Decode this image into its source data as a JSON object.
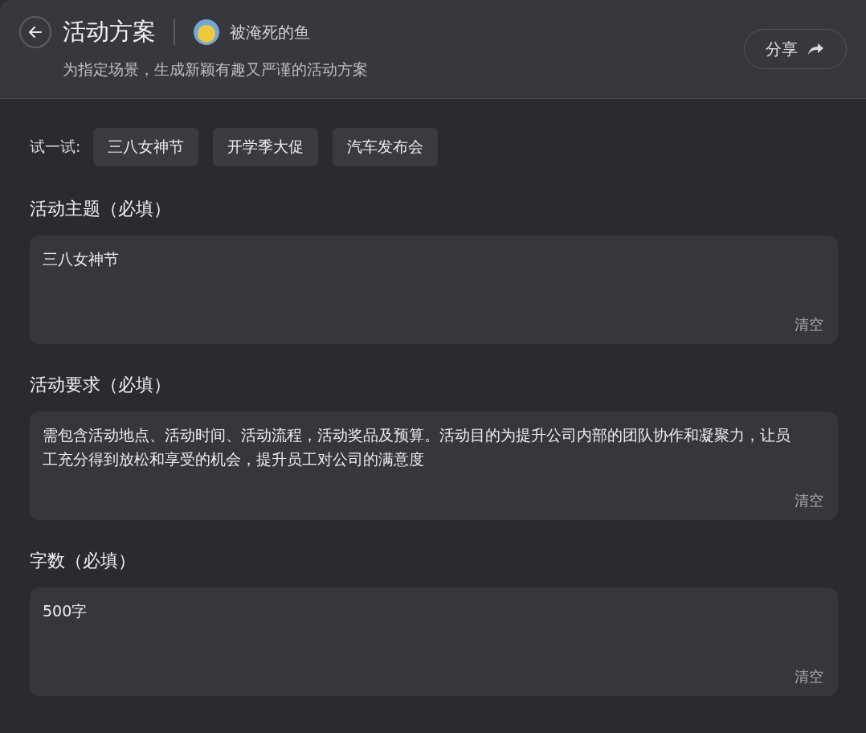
{
  "header": {
    "title": "活动方案",
    "author": "被淹死的鱼",
    "subtitle": "为指定场景，生成新颖有趣又严谨的活动方案",
    "share_button": "分享"
  },
  "suggestions": {
    "label": "试一试:",
    "items": [
      "三八女神节",
      "开学季大促",
      "汽车发布会"
    ]
  },
  "fields": [
    {
      "label": "活动主题（必填）",
      "value": "三八女神节",
      "clear": "清空"
    },
    {
      "label": "活动要求（必填）",
      "value": "需包含活动地点、活动时间、活动流程，活动奖品及预算。活动目的为提升公司内部的团队协作和凝聚力，让员工充分得到放松和享受的机会，提升员工对公司的满意度",
      "clear": "清空"
    },
    {
      "label": "字数（必填）",
      "value": "500字",
      "clear": "清空"
    }
  ]
}
